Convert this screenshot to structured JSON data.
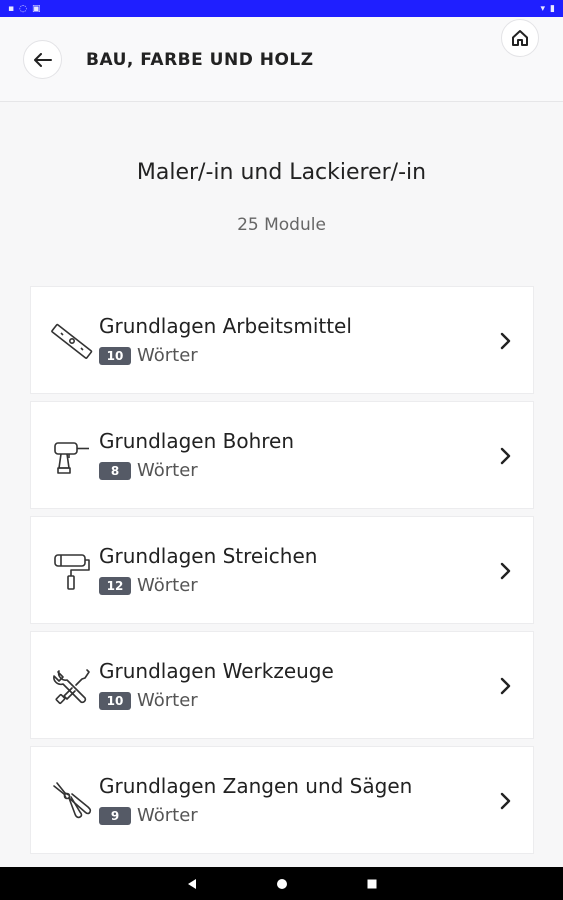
{
  "app_bar": {
    "title": "BAU, FARBE UND HOLZ"
  },
  "header": {
    "heading": "Maler/-in und Lackierer/-in",
    "subheading": "25 Module"
  },
  "modules": [
    {
      "title": "Grundlagen Arbeitsmittel",
      "count": "10",
      "unit": "Wörter",
      "icon": "spirit-level-icon"
    },
    {
      "title": "Grundlagen Bohren",
      "count": "8",
      "unit": "Wörter",
      "icon": "drill-icon"
    },
    {
      "title": "Grundlagen Streichen",
      "count": "12",
      "unit": "Wörter",
      "icon": "paint-roller-icon"
    },
    {
      "title": "Grundlagen Werkzeuge",
      "count": "10",
      "unit": "Wörter",
      "icon": "wrench-screwdriver-icon"
    },
    {
      "title": "Grundlagen Zangen und Sägen",
      "count": "9",
      "unit": "Wörter",
      "icon": "pliers-icon"
    }
  ],
  "colors": {
    "status_bar": "#1f1fff",
    "badge": "#555a66",
    "nav_bar": "#000000"
  }
}
